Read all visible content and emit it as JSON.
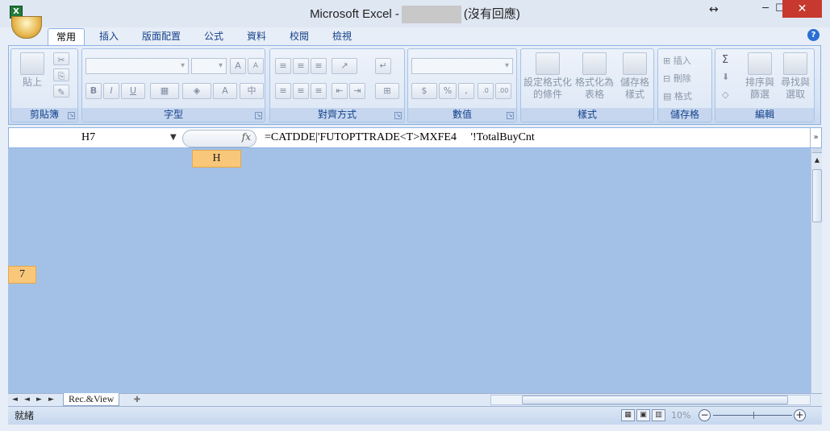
{
  "titlebar": {
    "app_title": "Microsoft Excel -",
    "status": "(沒有回應)",
    "resize_glyph": "↔",
    "min_glyph": "─",
    "max_glyph": "☐",
    "close_glyph": "✕"
  },
  "tabs": [
    "常用",
    "插入",
    "版面配置",
    "公式",
    "資料",
    "校閱",
    "檢視"
  ],
  "active_tab": "常用",
  "ribbon": {
    "clipboard": {
      "label": "剪貼簿",
      "paste": "貼上"
    },
    "font": {
      "label": "字型",
      "font_size_up": "A",
      "font_size_down": "A",
      "bold": "B",
      "italic": "I",
      "underline": "U"
    },
    "alignment": {
      "label": "對齊方式"
    },
    "number": {
      "label": "數值",
      "currency": "$",
      "percent": "%",
      "comma": ","
    },
    "styles": {
      "label": "樣式",
      "conditional_format_line1": "設定格式化",
      "conditional_format_line2": "的條件",
      "format_table_line1": "格式化為",
      "format_table_line2": "表格",
      "cell_styles_line1": "儲存格",
      "cell_styles_line2": "樣式"
    },
    "cells": {
      "label": "儲存格",
      "insert": "插入",
      "delete": "刪除",
      "format": "格式"
    },
    "editing": {
      "label": "編輯",
      "sum": "Σ",
      "sort_line1": "排序與",
      "sort_line2": "篩選",
      "find_line1": "尋找與",
      "find_line2": "選取"
    }
  },
  "formula_bar": {
    "name_box": "H7",
    "fx": "fx",
    "formula": "=CATDDE|'FUTOPTTRADE<T>MXFE4     '!TotalBuyCnt"
  },
  "sheet": {
    "column_header": "H",
    "row_header": "7",
    "tab_name": "Rec.&View"
  },
  "statusbar": {
    "status": "就緒",
    "zoom": "10%"
  },
  "colors": {
    "grid_bg": "#a3c1e7",
    "highlight_header": "#f8c77a",
    "close_button": "#c7392e"
  }
}
